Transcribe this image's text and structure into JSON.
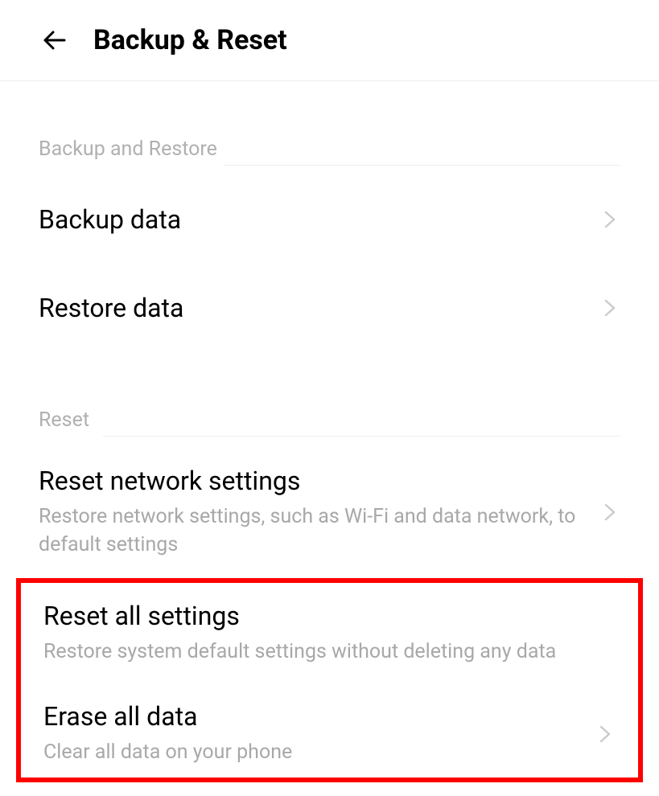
{
  "header": {
    "title": "Backup & Reset"
  },
  "sections": {
    "backup_restore": {
      "header": "Backup and Restore",
      "items": {
        "backup_data": {
          "title": "Backup data"
        },
        "restore_data": {
          "title": "Restore data"
        }
      }
    },
    "reset": {
      "header": "Reset",
      "items": {
        "reset_network": {
          "title": "Reset network settings",
          "subtitle": "Restore network settings, such as Wi-Fi and data network, to default settings"
        },
        "reset_all": {
          "title": "Reset all settings",
          "subtitle": "Restore system default settings without deleting any data"
        },
        "erase_all": {
          "title": "Erase all data",
          "subtitle": "Clear all data on your phone"
        }
      }
    }
  }
}
